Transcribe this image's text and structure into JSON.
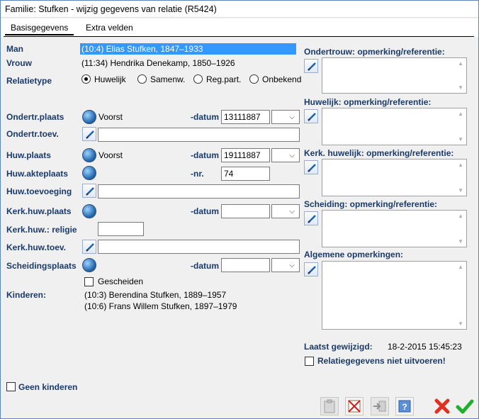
{
  "window": {
    "title": "Familie: Stufken - wijzig gegevens van relatie (R5424)"
  },
  "tabs": [
    {
      "label": "Basisgegevens"
    },
    {
      "label": "Extra velden"
    }
  ],
  "man": {
    "label": "Man",
    "value": "(10:4) Elias Stufken, 1847–1933"
  },
  "vrouw": {
    "label": "Vrouw",
    "value": "(11:34) Hendrika Denekamp, 1850–1926"
  },
  "relatietype": {
    "label": "Relatietype",
    "options": [
      "Huwelijk",
      "Samenw.",
      "Reg.part.",
      "Onbekend"
    ],
    "selected": "Huwelijk"
  },
  "fields": {
    "ondertr_plaats": {
      "label": "Ondertr.plaats",
      "value": "Voorst",
      "datum_label": "-datum",
      "datum": "13111887"
    },
    "ondertr_toev": {
      "label": "Ondertr.toev.",
      "value": ""
    },
    "huw_plaats": {
      "label": "Huw.plaats",
      "value": "Voorst",
      "datum_label": "-datum",
      "datum": "19111887"
    },
    "huw_akteplaats": {
      "label": "Huw.akteplaats",
      "nr_label": "-nr.",
      "nr": "74"
    },
    "huw_toevoeging": {
      "label": "Huw.toevoeging",
      "value": ""
    },
    "kerk_huw_plaats": {
      "label": "Kerk.huw.plaats",
      "datum_label": "-datum",
      "datum": ""
    },
    "kerk_huw_religie": {
      "label": "Kerk.huw.: religie",
      "value": ""
    },
    "kerk_huw_toev": {
      "label": "Kerk.huw.toev.",
      "value": ""
    },
    "scheidingsplaats": {
      "label": "Scheidingsplaats",
      "datum_label": "-datum",
      "datum": ""
    },
    "gescheiden": {
      "label": "Gescheiden",
      "checked": false
    }
  },
  "kinderen": {
    "label": "Kinderen:",
    "items": [
      "(10:3) Berendina Stufken, 1889–1957",
      "(10:6) Frans Willem Stufken, 1897–1979"
    ]
  },
  "geen_kinderen": {
    "label": "Geen kinderen",
    "checked": false
  },
  "remarks": [
    {
      "label": "Ondertrouw: opmerking/referentie:"
    },
    {
      "label": "Huwelijk: opmerking/referentie:"
    },
    {
      "label": "Kerk. huwelijk: opmerking/referentie:"
    },
    {
      "label": "Scheiding: opmerking/referentie:"
    },
    {
      "label": "Algemene opmerkingen:"
    }
  ],
  "laatst_gewijzigd": {
    "label": "Laatst gewijzigd:",
    "value": "18-2-2015 15:45:23"
  },
  "niet_uitvoeren": {
    "label": "Relatiegegevens niet uitvoeren!",
    "checked": false
  },
  "colors": {
    "label_blue": "#1a3a6a",
    "selection": "#3399ff",
    "ok_green": "#1fae2f",
    "cancel_red": "#e03020"
  }
}
